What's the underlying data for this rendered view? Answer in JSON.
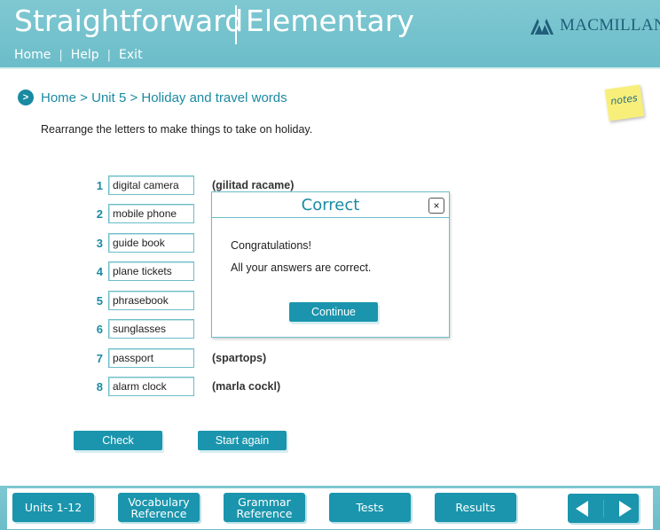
{
  "header": {
    "brand_main": "Straightforward",
    "brand_sub": "Elementary",
    "publisher": "MACMILLAN",
    "nav": [
      "Home",
      "Help",
      "Exit"
    ]
  },
  "breadcrumb": "Home > Unit 5 > Holiday and travel words",
  "notes_label": "notes",
  "instruction": "Rearrange the letters to make things to take on holiday.",
  "exercise": {
    "items": [
      {
        "num": "1",
        "answer": "digital camera",
        "clue": "(gilitad racame)"
      },
      {
        "num": "2",
        "answer": "mobile phone",
        "clue": ""
      },
      {
        "num": "3",
        "answer": "guide book",
        "clue": ""
      },
      {
        "num": "4",
        "answer": "plane tickets",
        "clue": ""
      },
      {
        "num": "5",
        "answer": "phrasebook",
        "clue": ""
      },
      {
        "num": "6",
        "answer": "sunglasses",
        "clue": ""
      },
      {
        "num": "7",
        "answer": "passport",
        "clue": "(spartops)"
      },
      {
        "num": "8",
        "answer": "alarm clock",
        "clue": "(marla cockl)"
      }
    ],
    "check_label": "Check",
    "start_again_label": "Start again"
  },
  "dialog": {
    "title": "Correct",
    "close_glyph": "×",
    "line1": "Congratulations!",
    "line2": "All your answers are correct.",
    "continue_label": "Continue"
  },
  "footer": {
    "units": "Units 1-12",
    "vocab_line1": "Vocabulary",
    "vocab_line2": "Reference",
    "grammar_line1": "Grammar",
    "grammar_line2": "Reference",
    "tests": "Tests",
    "results": "Results"
  },
  "colors": {
    "header_teal": "#6bbdc9",
    "accent_teal": "#1a95ad",
    "text_teal": "#1a8aa2",
    "notes_yellow": "#f7ef7a"
  },
  "icons": [
    "publisher-logo-icon",
    "breadcrumb-arrow-icon",
    "close-icon",
    "previous-arrow-icon",
    "next-arrow-icon"
  ]
}
